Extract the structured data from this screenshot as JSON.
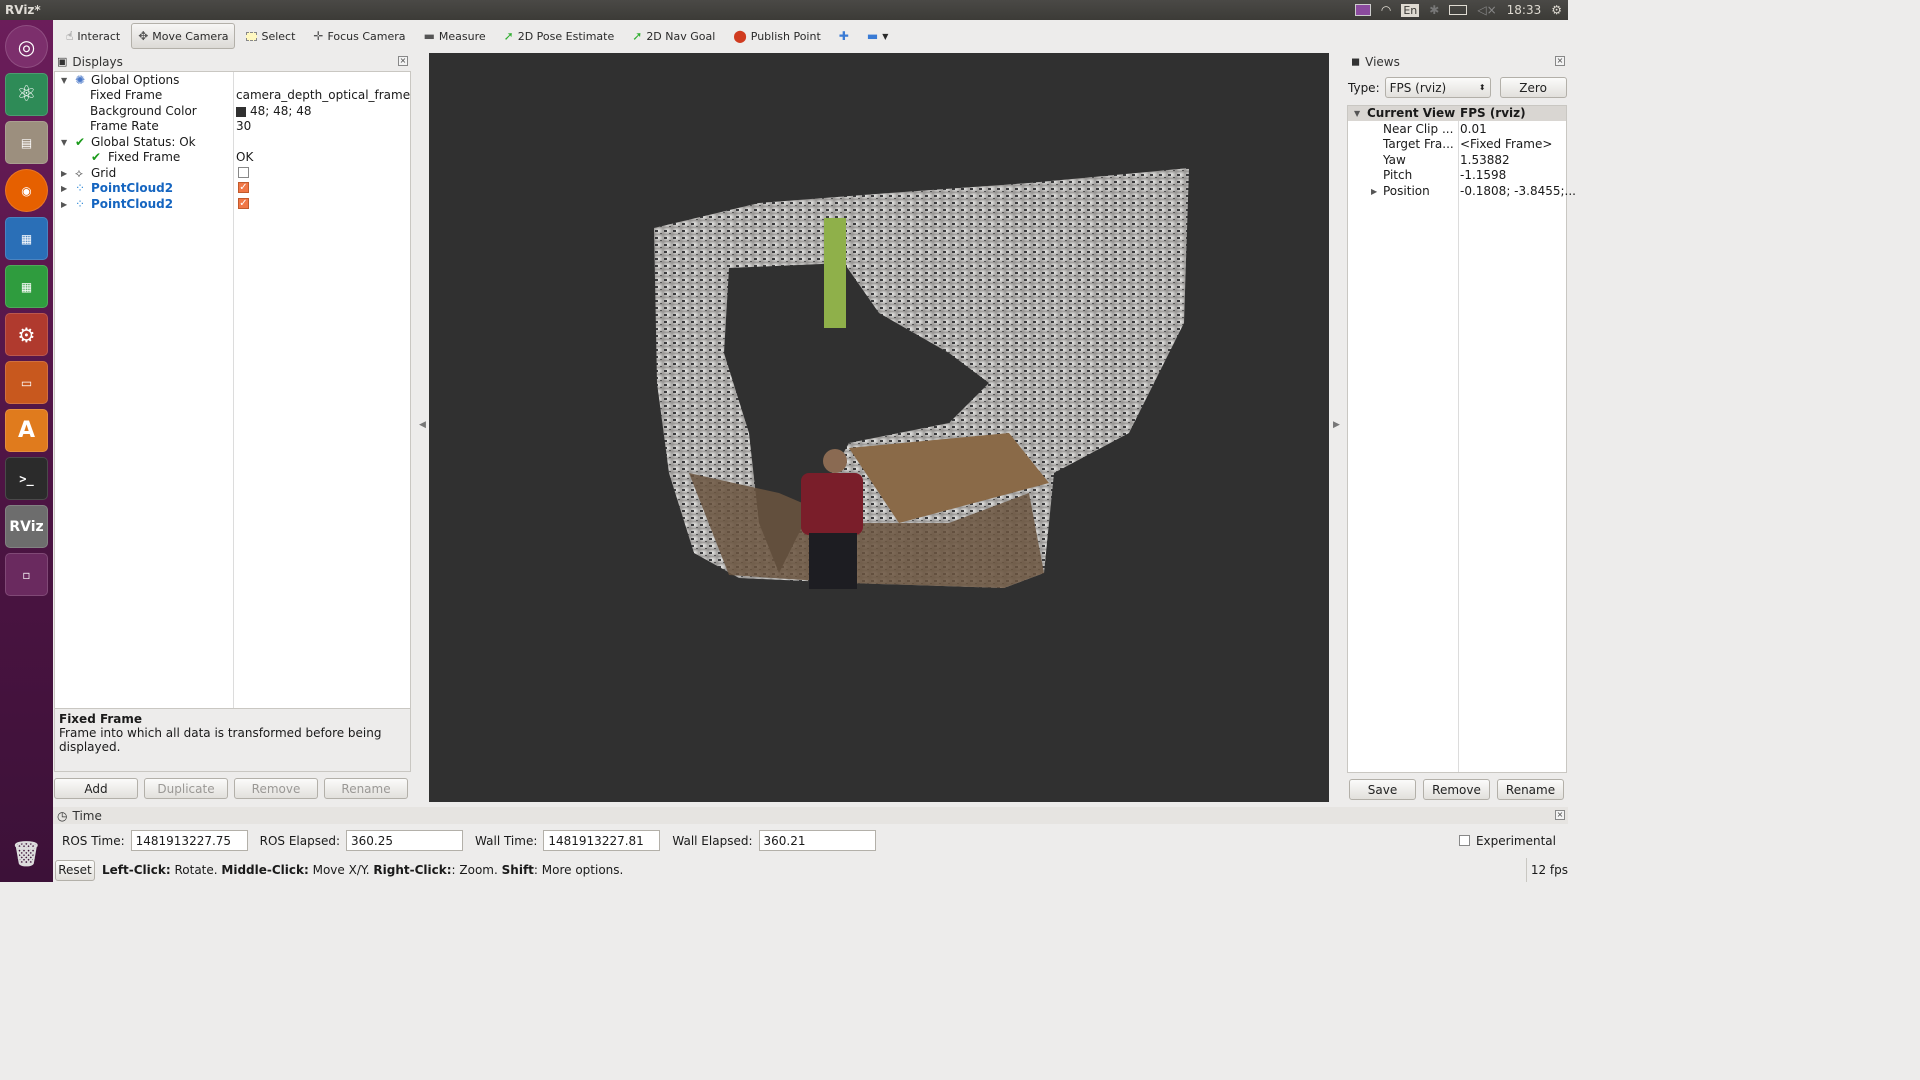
{
  "window": {
    "title": "RViz*"
  },
  "tray": {
    "lang": "En",
    "clock": "18:33"
  },
  "toolbar": {
    "items": [
      {
        "label": "Interact",
        "icon": "hand-icon"
      },
      {
        "label": "Move Camera",
        "icon": "move-camera-icon"
      },
      {
        "label": "Select",
        "icon": "select-rect-icon"
      },
      {
        "label": "Focus Camera",
        "icon": "focus-camera-icon"
      },
      {
        "label": "Measure",
        "icon": "ruler-icon"
      },
      {
        "label": "2D Pose Estimate",
        "icon": "green-arrow-icon"
      },
      {
        "label": "2D Nav Goal",
        "icon": "green-arrow-icon"
      },
      {
        "label": "Publish Point",
        "icon": "red-pin-icon"
      }
    ]
  },
  "displays": {
    "title": "Displays",
    "rows": [
      {
        "key": "Global Options",
        "value": ""
      },
      {
        "key": "Fixed Frame",
        "value": "camera_depth_optical_frame"
      },
      {
        "key": "Background Color",
        "value": "48; 48; 48"
      },
      {
        "key": "Frame Rate",
        "value": "30"
      },
      {
        "key": "Global Status: Ok",
        "value": ""
      },
      {
        "key": "Fixed Frame",
        "value": "OK"
      },
      {
        "key": "Grid",
        "value": ""
      },
      {
        "key": "PointCloud2",
        "value": ""
      },
      {
        "key": "PointCloud2",
        "value": ""
      }
    ],
    "description_title": "Fixed Frame",
    "description_text": "Frame into which all data is transformed before being displayed.",
    "buttons": {
      "add": "Add",
      "duplicate": "Duplicate",
      "remove": "Remove",
      "rename": "Rename"
    }
  },
  "views": {
    "title": "Views",
    "type_label": "Type:",
    "type_value": "FPS (rviz)",
    "zero_label": "Zero",
    "header": {
      "key": "Current View",
      "value": "FPS (rviz)"
    },
    "rows": [
      {
        "key": "Near Clip ...",
        "value": "0.01"
      },
      {
        "key": "Target Fra...",
        "value": "<Fixed Frame>"
      },
      {
        "key": "Yaw",
        "value": "1.53882"
      },
      {
        "key": "Pitch",
        "value": "-1.1598"
      },
      {
        "key": "Position",
        "value": "-0.1808; -3.8455;..."
      }
    ],
    "buttons": {
      "save": "Save",
      "remove": "Remove",
      "rename": "Rename"
    }
  },
  "time": {
    "title": "Time",
    "ros_time_label": "ROS Time:",
    "ros_time": "1481913227.75",
    "ros_elapsed_label": "ROS Elapsed:",
    "ros_elapsed": "360.25",
    "wall_time_label": "Wall Time:",
    "wall_time": "1481913227.81",
    "wall_elapsed_label": "Wall Elapsed:",
    "wall_elapsed": "360.21",
    "experimental_label": "Experimental"
  },
  "status": {
    "reset": "Reset",
    "left_b": "Left-Click:",
    "left_t": " Rotate. ",
    "mid_b": "Middle-Click:",
    "mid_t": " Move X/Y. ",
    "right_b": "Right-Click:",
    "right_t": ": Zoom. ",
    "shift_b": "Shift",
    "shift_t": ": More options.",
    "fps": "12 fps"
  },
  "colors": {
    "viewport_bg": "#303030",
    "launcher": "#5a1a4f",
    "link": "#1565c0",
    "checkbox": "#f07746"
  }
}
